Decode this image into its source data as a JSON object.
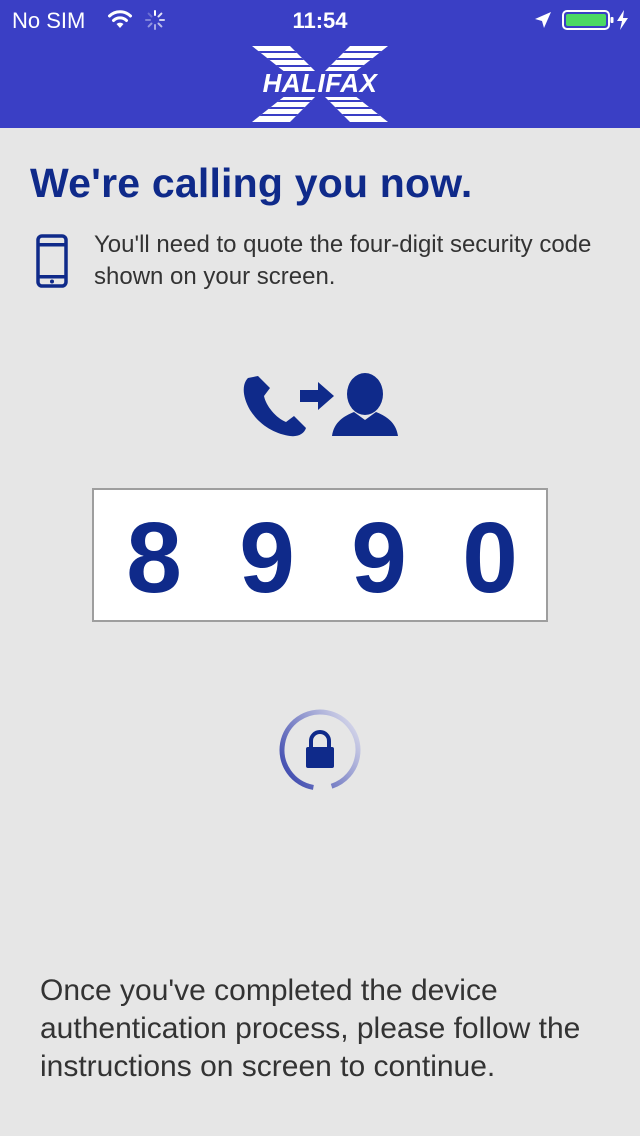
{
  "status_bar": {
    "carrier": "No SIM",
    "time": "11:54"
  },
  "header": {
    "logo_text": "HALIFAX"
  },
  "headline": "We're calling you now.",
  "instruction": "You'll need to quote the four-digit security code shown on your screen.",
  "security_code": [
    "8",
    "9",
    "9",
    "0"
  ],
  "footer": "Once you've completed the device authentication process, please follow the instructions on screen to continue.",
  "colors": {
    "header_bg": "#3a3fc5",
    "brand_blue": "#0f2a8a",
    "page_bg": "#e6e6e6",
    "battery": "#4cd964"
  },
  "icons": [
    "wifi-icon",
    "activity-spinner-icon",
    "location-arrow-icon",
    "battery-icon",
    "charging-bolt-icon",
    "mobile-phone-icon",
    "phone-call-icon",
    "arrow-right-icon",
    "person-icon",
    "lock-icon"
  ]
}
